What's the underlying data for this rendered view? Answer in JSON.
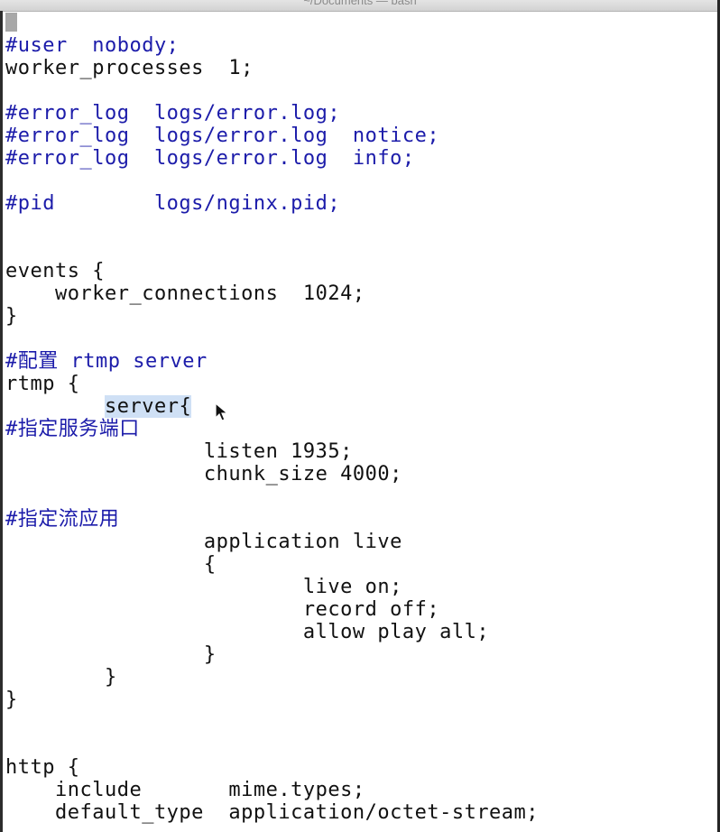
{
  "window": {
    "title": "~/Documents — bash"
  },
  "editor": {
    "lines": [
      {
        "text": "#user  nobody;",
        "type": "comment"
      },
      {
        "text": "worker_processes  1;",
        "type": "code"
      },
      {
        "text": "",
        "type": "code"
      },
      {
        "text": "#error_log  logs/error.log;",
        "type": "comment"
      },
      {
        "text": "#error_log  logs/error.log  notice;",
        "type": "comment"
      },
      {
        "text": "#error_log  logs/error.log  info;",
        "type": "comment"
      },
      {
        "text": "",
        "type": "code"
      },
      {
        "text": "#pid        logs/nginx.pid;",
        "type": "comment"
      },
      {
        "text": "",
        "type": "code"
      },
      {
        "text": "",
        "type": "code"
      },
      {
        "text": "events {",
        "type": "code"
      },
      {
        "text": "    worker_connections  1024;",
        "type": "code"
      },
      {
        "text": "}",
        "type": "code"
      },
      {
        "text": "",
        "type": "code"
      },
      {
        "text": "#配置 rtmp server",
        "type": "comment"
      },
      {
        "text": "rtmp {",
        "type": "code"
      },
      {
        "text": "        server{",
        "type": "code",
        "indent": "        ",
        "selected": "server{"
      },
      {
        "text": "#指定服务端口",
        "type": "comment"
      },
      {
        "text": "                listen 1935;",
        "type": "code"
      },
      {
        "text": "                chunk_size 4000;",
        "type": "code"
      },
      {
        "text": "",
        "type": "code"
      },
      {
        "text": "#指定流应用",
        "type": "comment"
      },
      {
        "text": "                application live",
        "type": "code"
      },
      {
        "text": "                {",
        "type": "code"
      },
      {
        "text": "                        live on;",
        "type": "code"
      },
      {
        "text": "                        record off;",
        "type": "code"
      },
      {
        "text": "                        allow play all;",
        "type": "code"
      },
      {
        "text": "                }",
        "type": "code"
      },
      {
        "text": "        }",
        "type": "code"
      },
      {
        "text": "}",
        "type": "code"
      },
      {
        "text": "",
        "type": "code"
      },
      {
        "text": "",
        "type": "code"
      },
      {
        "text": "http {",
        "type": "code"
      },
      {
        "text": "    include       mime.types;",
        "type": "code"
      },
      {
        "text": "    default_type  application/octet-stream;",
        "type": "code"
      }
    ]
  },
  "colors": {
    "comment": "#1c1caa",
    "code": "#111111",
    "selection": "#cfe0f5",
    "background": "#ffffff"
  },
  "icons": {
    "mouse_pointer": "mouse-pointer-icon"
  }
}
